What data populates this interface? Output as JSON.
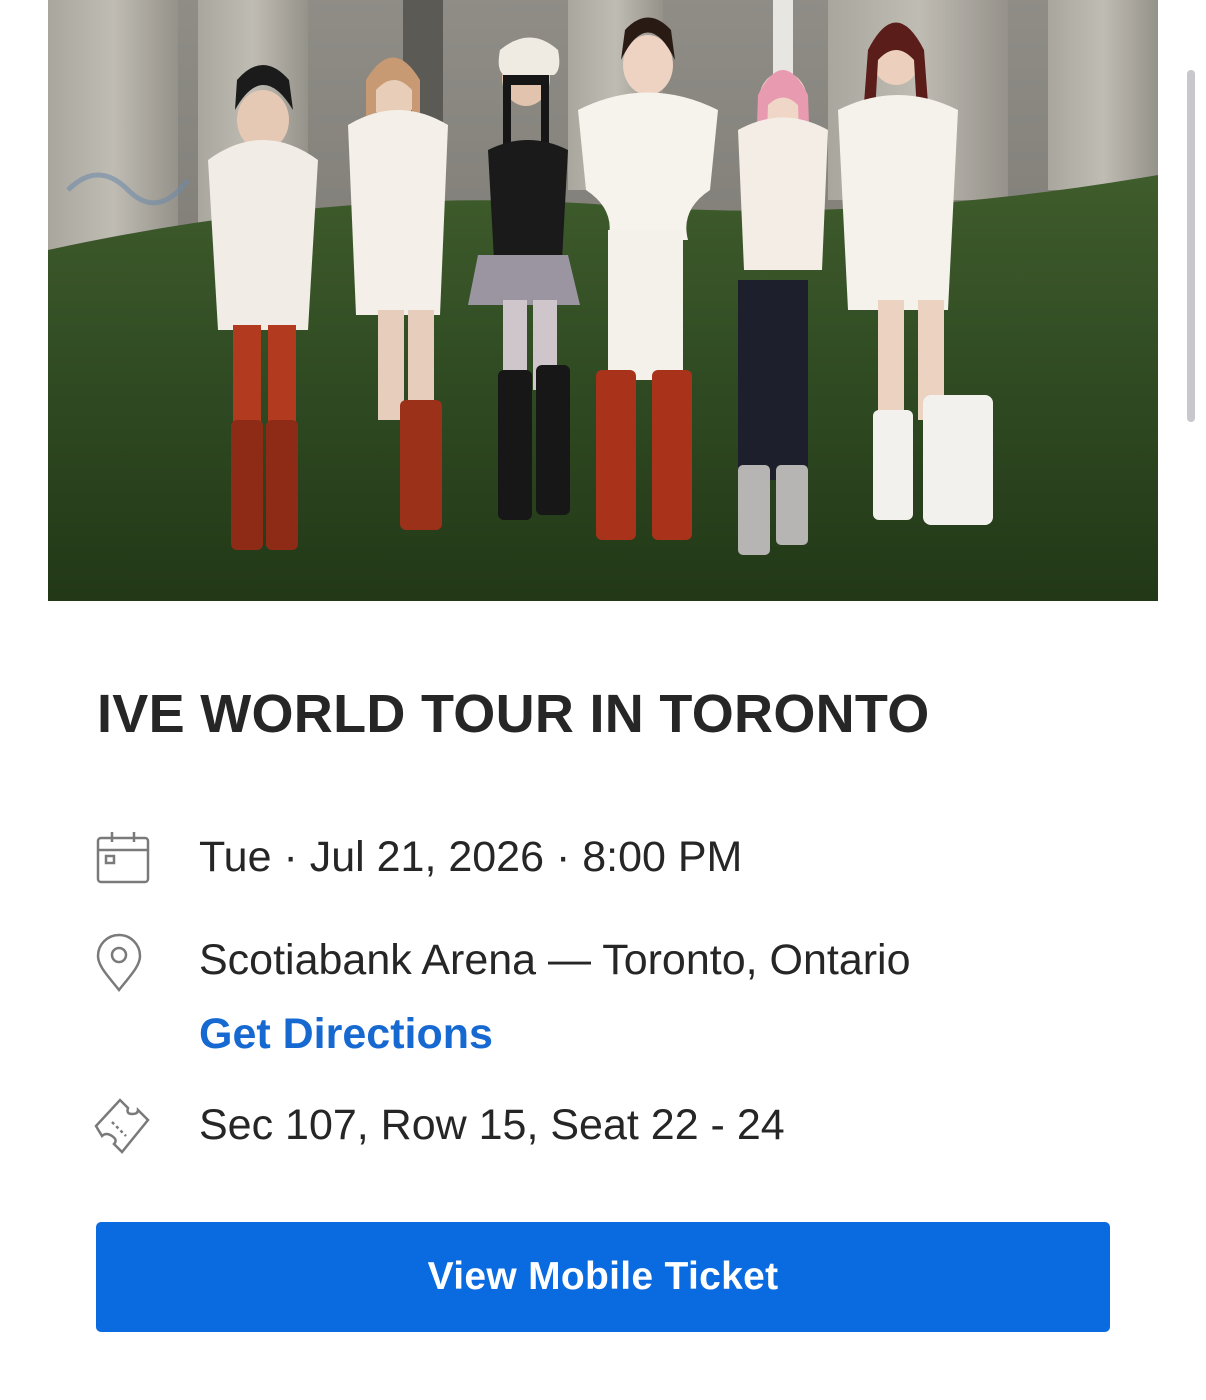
{
  "hero": {
    "image": "group-photo-six-performers"
  },
  "event": {
    "title": "IVE WORLD TOUR IN TORONTO",
    "datetime": "Tue · Jul 21, 2026 · 8:00 PM",
    "venue": "Scotiabank Arena — Toronto, Ontario",
    "directions_label": "Get Directions",
    "seats": "Sec 107, Row 15, Seat 22 - 24"
  },
  "icons": {
    "date": "calendar-icon",
    "venue": "location-pin-icon",
    "seats": "ticket-icon"
  },
  "actions": {
    "view_ticket_label": "View Mobile Ticket"
  },
  "colors": {
    "accent": "#0a6be0",
    "link": "#1769d2",
    "text": "#262626",
    "icon": "#7a7a7a"
  }
}
